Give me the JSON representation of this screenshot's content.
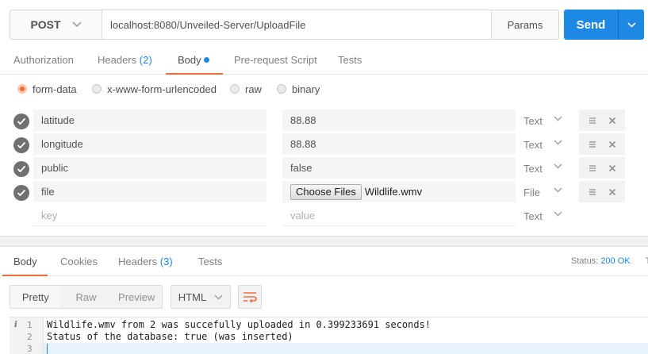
{
  "request": {
    "method": "POST",
    "url": "localhost:8080/Unveiled-Server/UploadFile",
    "params_label": "Params",
    "send_label": "Send"
  },
  "request_tabs": [
    {
      "label": "Authorization",
      "count": ""
    },
    {
      "label": "Headers",
      "count": "(2)"
    },
    {
      "label": "Body",
      "count": "",
      "active": true
    },
    {
      "label": "Pre-request Script",
      "count": ""
    },
    {
      "label": "Tests",
      "count": ""
    }
  ],
  "body_types": [
    {
      "label": "form-data",
      "selected": true
    },
    {
      "label": "x-www-form-urlencoded",
      "selected": false
    },
    {
      "label": "raw",
      "selected": false
    },
    {
      "label": "binary",
      "selected": false
    }
  ],
  "form_rows": [
    {
      "key": "latitude",
      "value": "88.88",
      "type": "Text"
    },
    {
      "key": "longitude",
      "value": "88.88",
      "type": "Text"
    },
    {
      "key": "public",
      "value": "false",
      "type": "Text"
    },
    {
      "key": "file",
      "file_button": "Choose Files",
      "file_name": "Wildlife.wmv",
      "type": "File"
    }
  ],
  "new_row": {
    "key_placeholder": "key",
    "value_placeholder": "value",
    "type": "Text"
  },
  "response_tabs": [
    {
      "label": "Body",
      "count": "",
      "active": true
    },
    {
      "label": "Cookies",
      "count": ""
    },
    {
      "label": "Headers",
      "count": "(3)"
    },
    {
      "label": "Tests",
      "count": ""
    }
  ],
  "status": {
    "label": "Status:",
    "value": "200 OK",
    "overflow": "T"
  },
  "view_modes": [
    "Pretty",
    "Raw",
    "Preview"
  ],
  "format": "HTML",
  "response_lines": [
    {
      "num": "1",
      "text": "Wildlife.wmv from 2 was succefully uploaded in 0.399233691 seconds!"
    },
    {
      "num": "2",
      "text": "Status of the database: true (was inserted)"
    },
    {
      "num": "3",
      "text": ""
    }
  ],
  "colors": {
    "accent": "#1e88e5",
    "tab_underline": "#f26b3a",
    "radio_selected": "#f26b3a"
  }
}
